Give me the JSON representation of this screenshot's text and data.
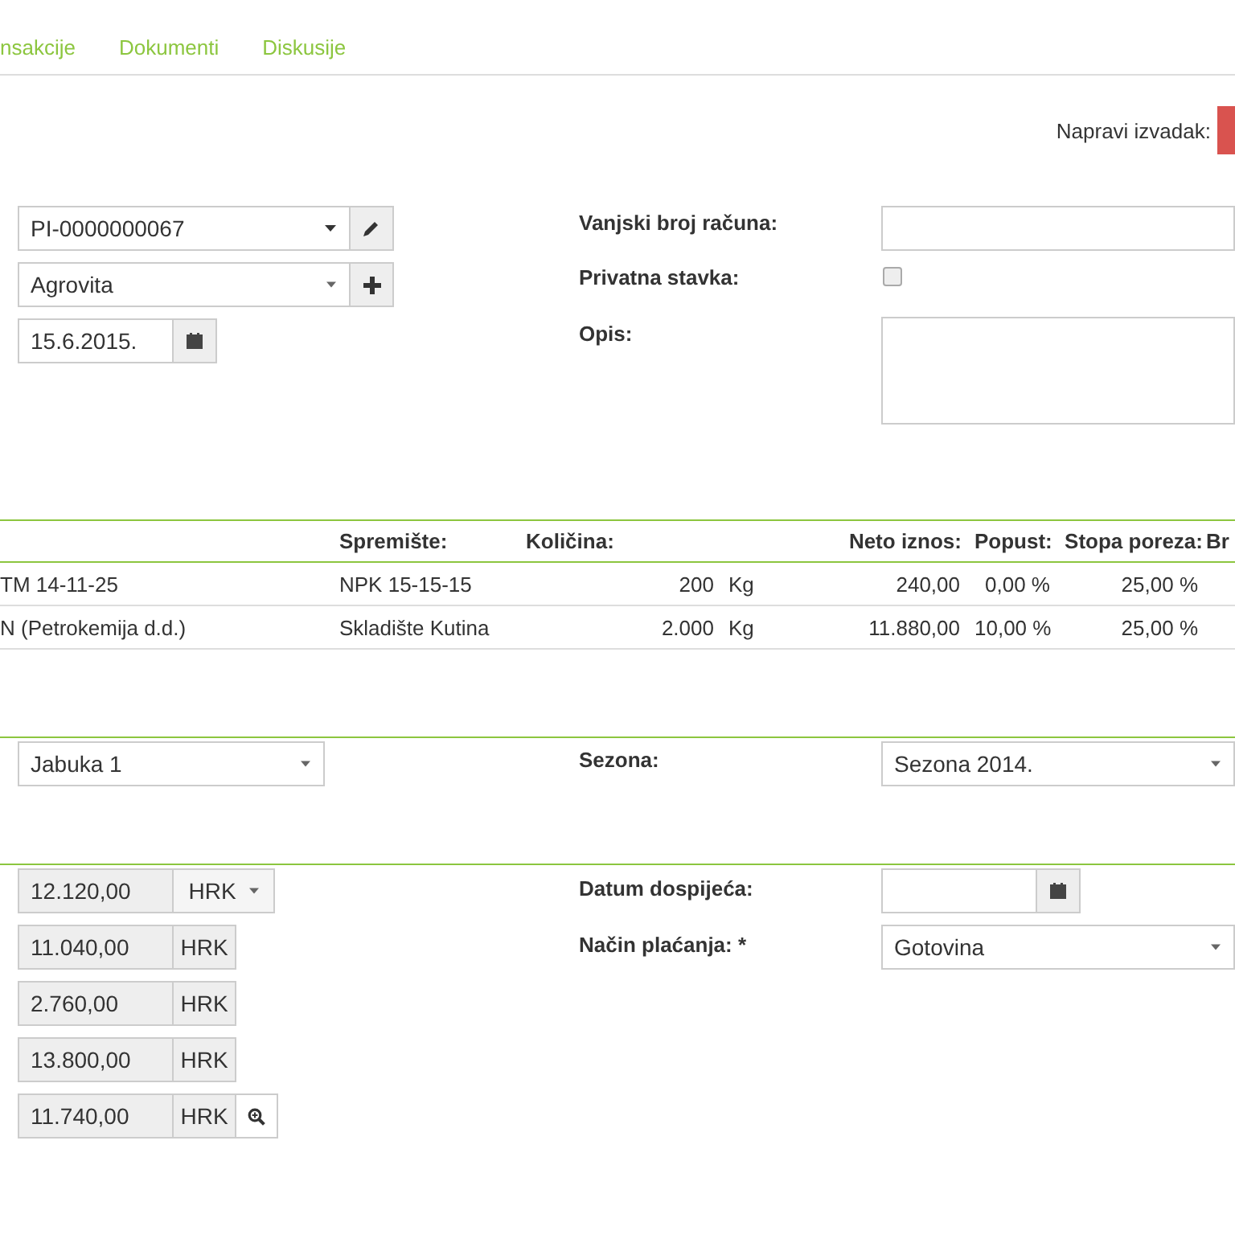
{
  "tabs": [
    {
      "label": "nsakcije"
    },
    {
      "label": "Dokumenti"
    },
    {
      "label": "Diskusije"
    }
  ],
  "export": {
    "label": "Napravi izvadak:"
  },
  "header_form": {
    "document": "PI-0000000067",
    "partner": "Agrovita",
    "date": "15.6.2015.",
    "external_number": {
      "label": "Vanjski broj računa:"
    },
    "private_item": {
      "label": "Privatna stavka:",
      "checked": false
    },
    "description": {
      "label": "Opis:"
    }
  },
  "table": {
    "columns": [
      "Spremište:",
      "Količina:",
      "Neto iznos:",
      "Popust:",
      "Stopa poreza:",
      "Br"
    ],
    "rows": [
      {
        "item": "TM 14-11-25",
        "storage": "NPK 15-15-15",
        "quantity": "200",
        "unit": "Kg",
        "net": "240,00",
        "discount": "0,00 %",
        "tax": "25,00 %"
      },
      {
        "item": "N (Petrokemija d.d.)",
        "storage": "Skladište Kutina",
        "quantity": "2.000",
        "unit": "Kg",
        "net": "11.880,00",
        "discount": "10,00 %",
        "tax": "25,00 %"
      }
    ]
  },
  "season_section": {
    "orchard": "Jabuka 1",
    "season_label": "Sezona:",
    "season": "Sezona 2014."
  },
  "totals": [
    {
      "amount": "12.120,00",
      "currency": "HRK",
      "kind": "dropdown"
    },
    {
      "amount": "11.040,00",
      "currency": "HRK",
      "kind": "plain"
    },
    {
      "amount": "2.760,00",
      "currency": "HRK",
      "kind": "plain"
    },
    {
      "amount": "13.800,00",
      "currency": "HRK",
      "kind": "plain"
    },
    {
      "amount": "11.740,00",
      "currency": "HRK",
      "kind": "lookup"
    }
  ],
  "payment": {
    "due_date_label": "Datum dospijeća:",
    "method_label": "Način plaćanja: *",
    "method": "Gotovina"
  }
}
